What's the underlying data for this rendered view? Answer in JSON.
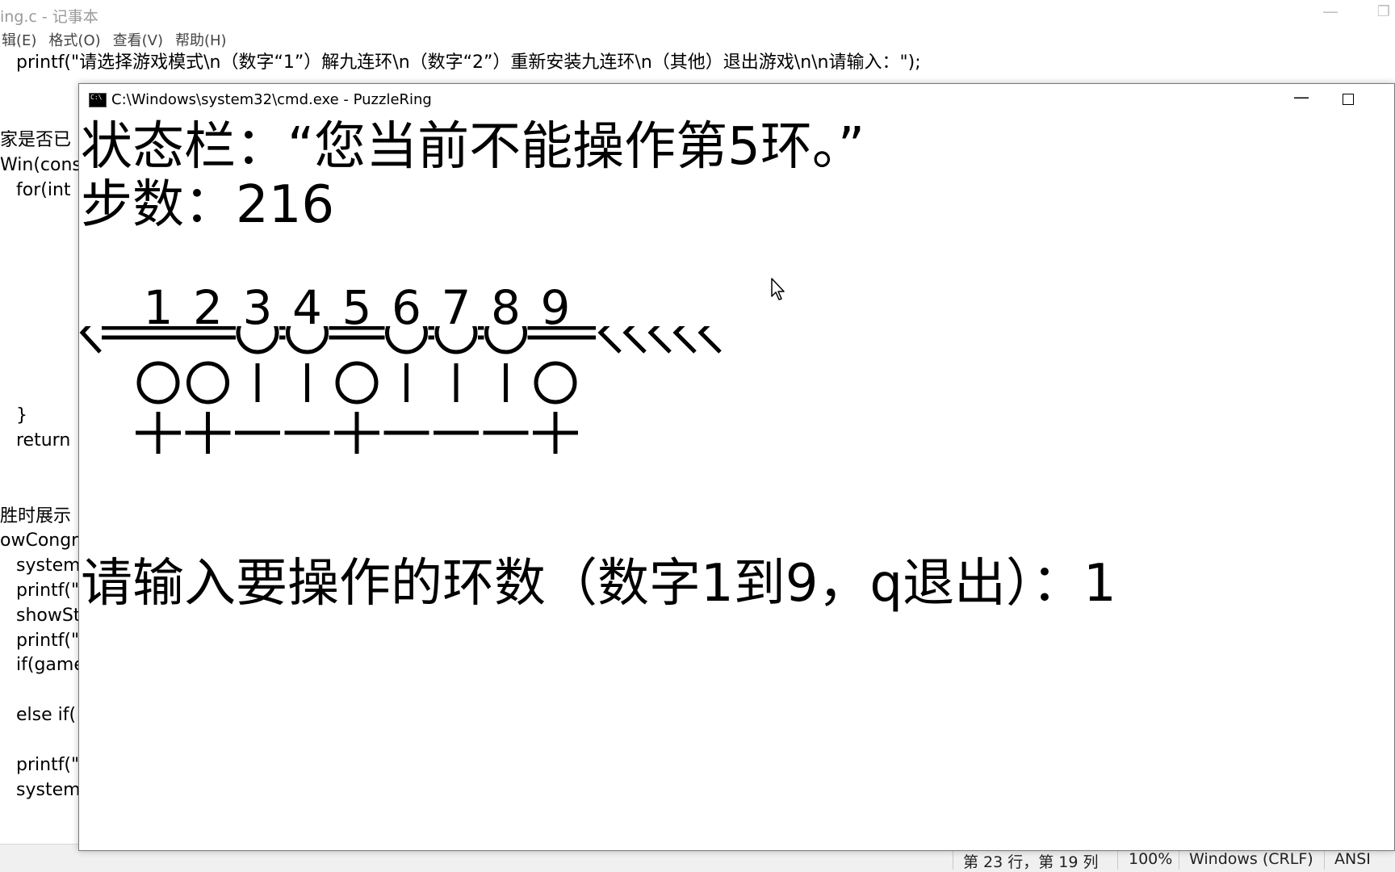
{
  "notepad": {
    "title": "ing.c - 记事本",
    "menu": {
      "edit": "辑(E)",
      "format": "格式(O)",
      "view": "查看(V)",
      "help": "帮助(H)"
    },
    "code_lines": [
      "printf(\"请选择游戏模式\\n（数字“1”）解九连环\\n（数字“2”）重新安装九连环\\n（其他）退出游戏\\n\\n请输入：\");",
      "家是否已",
      "Win(cons",
      "for(int",
      "}",
      "return",
      "胜时展示",
      "owCongra",
      "system",
      "printf(\"",
      "showSt",
      "printf(\"",
      "if(game",
      "else if(",
      "printf(\"",
      "system"
    ],
    "statusbar": {
      "position": "第 23 行，第 19 列",
      "zoom": "100%",
      "line_ending": "Windows (CRLF)",
      "encoding": "ANSI"
    }
  },
  "cmd": {
    "title": "C:\\Windows\\system32\\cmd.exe - PuzzleRing",
    "icon_text": "C:\\",
    "status_line": "状态栏：“您当前不能操作第5环。”",
    "steps_line": "步数：216",
    "prompt_line": "请输入要操作的环数（数字1到9，q退出）：1",
    "ring_numbers": [
      "1",
      "2",
      "3",
      "4",
      "5",
      "6",
      "7",
      "8",
      "9"
    ],
    "rings_on_bar": [
      false,
      false,
      true,
      true,
      false,
      true,
      true,
      true,
      false
    ],
    "icons": {
      "bar_left": "left-chevron",
      "bar_right": "left-chevrons",
      "ring_up": "circle",
      "ring_down": "vertical-bar"
    }
  }
}
